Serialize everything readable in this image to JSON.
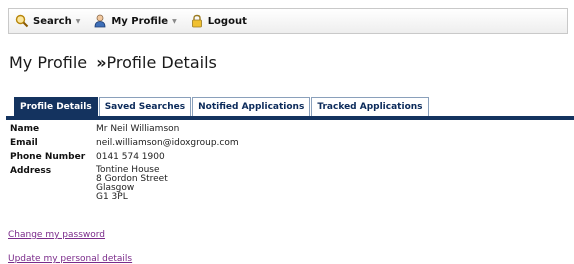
{
  "toolbar": {
    "items": [
      {
        "label": "Search",
        "icon": "search-icon",
        "has_dropdown": true
      },
      {
        "label": "My Profile",
        "icon": "user-icon",
        "has_dropdown": true
      },
      {
        "label": "Logout",
        "icon": "lock-icon",
        "has_dropdown": false
      }
    ]
  },
  "page": {
    "title_part1": "My Profile",
    "separator": "»",
    "title_part2": "Profile Details"
  },
  "tabs": [
    {
      "label": "Profile Details",
      "active": true
    },
    {
      "label": "Saved Searches",
      "active": false
    },
    {
      "label": "Notified Applications",
      "active": false
    },
    {
      "label": "Tracked Applications",
      "active": false
    }
  ],
  "details": {
    "name_label": "Name",
    "name_value": "Mr Neil Williamson",
    "email_label": "Email",
    "email_value": "neil.williamson@idoxgroup.com",
    "phone_label": "Phone Number",
    "phone_value": "0141 574 1900",
    "address_label": "Address",
    "address_lines": [
      "Tontine House",
      "8 Gordon Street",
      "Glasgow",
      "G1 3PL"
    ]
  },
  "links": {
    "change_password": "Change my password",
    "update_details": "Update my personal details"
  },
  "colors": {
    "tab_active_bg": "#14335f",
    "tab_text": "#0b2a5a",
    "link": "#7a2a8a"
  }
}
